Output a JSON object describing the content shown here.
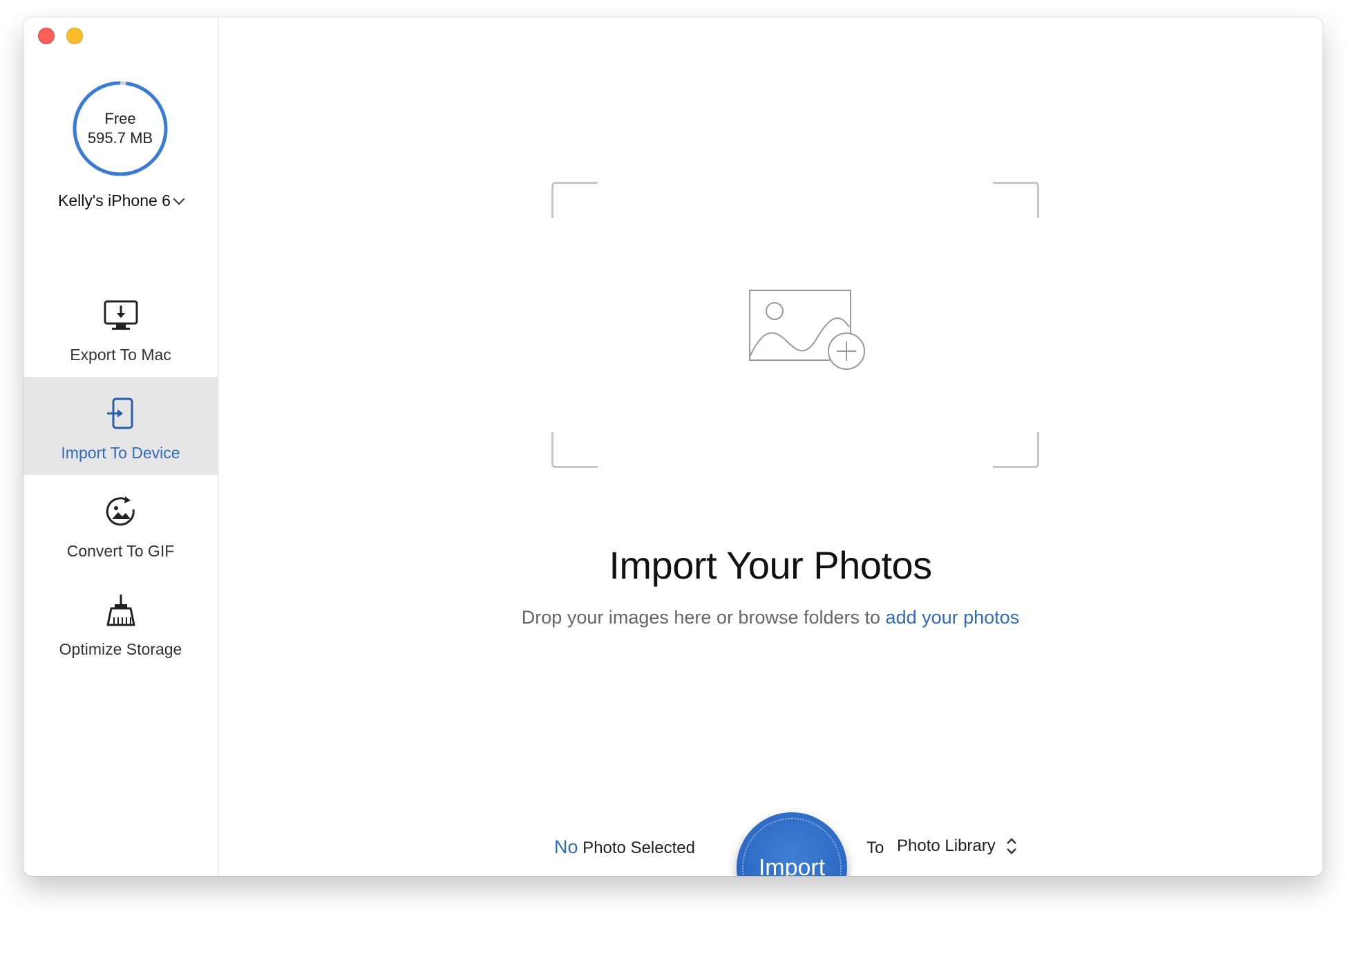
{
  "window": {
    "controls": [
      "close",
      "minimize"
    ]
  },
  "sidebar": {
    "storage": {
      "label": "Free",
      "value": "595.7 MB",
      "used_fraction": 0.02,
      "ring_color": "#3a7bd5"
    },
    "device_name": "Kelly's iPhone 6",
    "items": [
      {
        "label": "Export To Mac",
        "icon": "monitor-download-icon",
        "active": false
      },
      {
        "label": "Import To Device",
        "icon": "phone-import-icon",
        "active": true
      },
      {
        "label": "Convert To GIF",
        "icon": "gif-convert-icon",
        "active": false
      },
      {
        "label": "Optimize Storage",
        "icon": "broom-icon",
        "active": false
      }
    ]
  },
  "main": {
    "title": "Import Your Photos",
    "subtitle_text": "Drop your images here or browse folders to ",
    "subtitle_link": "add your photos",
    "drop_icon": "photo-add-icon"
  },
  "footer": {
    "selected_count": "No",
    "selected_text": " Photo Selected",
    "import_label": "Import",
    "to_label": "To",
    "destination": "Photo Library"
  },
  "colors": {
    "accent": "#2f6bb6",
    "button": "#2b66c1",
    "active_bg": "#e6e6e6"
  }
}
